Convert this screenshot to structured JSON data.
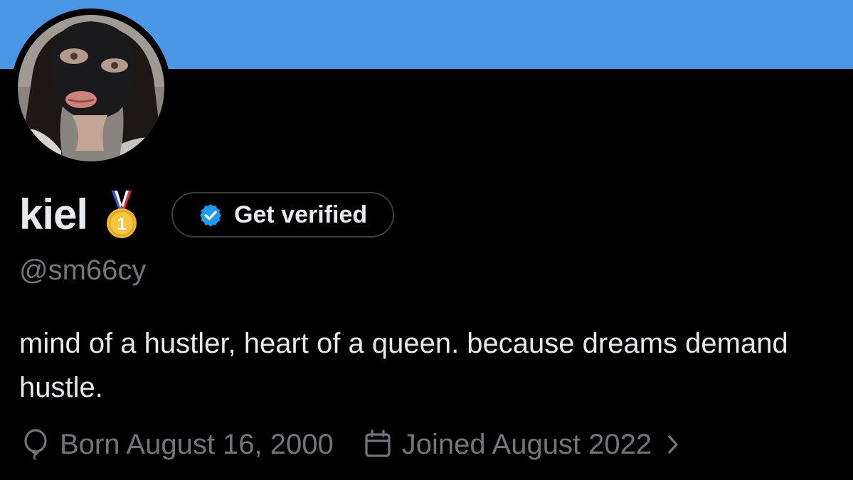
{
  "profile": {
    "display_name": "kiel",
    "handle": "@sm66cy",
    "bio": "mind of a hustler, heart of a queen. because dreams demand hustle.",
    "badge_icon": "first-place-medal-icon",
    "verify_button_label": "Get verified",
    "born_text": "Born August 16, 2000",
    "joined_text": "Joined August 2022"
  },
  "colors": {
    "banner": "#4a98e5",
    "background": "#000000",
    "primary_text": "#e7e9ea",
    "secondary_text": "#71767b",
    "verified_blue": "#1d9bf0"
  }
}
